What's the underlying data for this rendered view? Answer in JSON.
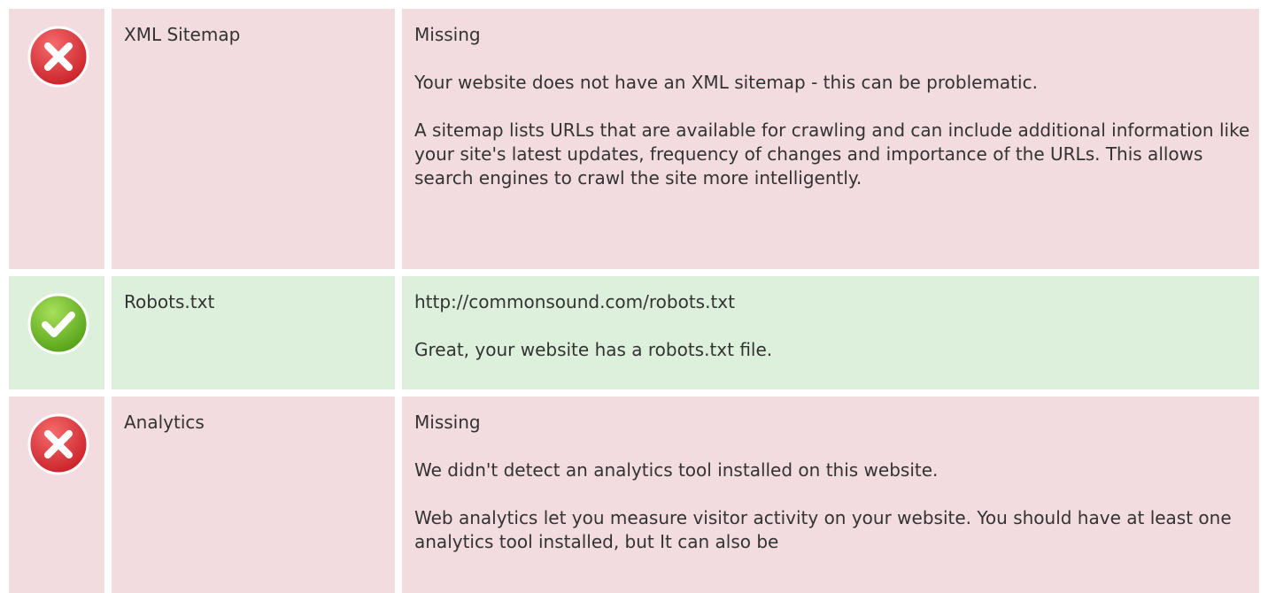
{
  "checks": [
    {
      "status": "error",
      "status_icon": "error-x-icon",
      "name": "XML Sitemap",
      "value": "Missing",
      "message": "Your website does not have an XML sitemap - this can be problematic.",
      "detail": "A sitemap lists URLs that are available for crawling and can include additional information like your site's latest updates, frequency of changes and importance of the URLs. This allows search engines to crawl the site more intelligently."
    },
    {
      "status": "ok",
      "status_icon": "success-check-icon",
      "name": "Robots.txt",
      "value": "http://commonsound.com/robots.txt",
      "message": "Great, your website has a robots.txt file."
    },
    {
      "status": "error",
      "status_icon": "error-x-icon",
      "name": "Analytics",
      "value": "Missing",
      "message": "We didn't detect an analytics tool installed on this website.",
      "detail": "Web analytics let you measure visitor activity on your website. You should have at least one analytics tool installed, but It can also be"
    }
  ],
  "colors": {
    "error_bg": "#f2dcdf",
    "ok_bg": "#ddf0db",
    "error_icon": "#e0393e",
    "ok_icon": "#6bbf2a",
    "text": "#333333"
  }
}
